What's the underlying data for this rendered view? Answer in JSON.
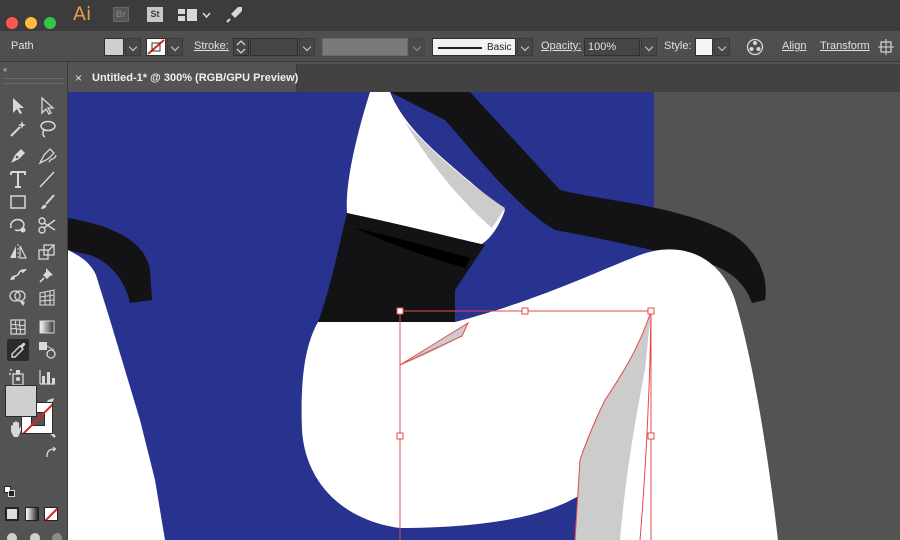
{
  "app": {
    "logo": "Ai",
    "bridge_badge": "Br",
    "stock_badge": "St"
  },
  "controlbar": {
    "selection_type": "Path",
    "fill_color": "#cfcfcf",
    "stroke_color": "none",
    "stroke_label": "Stroke:",
    "stroke_weight": "",
    "brush_profile_label": "Basic",
    "opacity_label": "Opacity:",
    "opacity_value": "100%",
    "style_label": "Style:",
    "align_label": "Align",
    "transform_label": "Transform"
  },
  "document": {
    "tab_close": "×",
    "tab_title": "Untitled-1* @ 300% (RGB/GPU Preview)"
  },
  "tools": [
    "selection-tool",
    "direct-selection-tool",
    "magic-wand-tool",
    "lasso-tool",
    "pen-tool",
    "curvature-tool",
    "type-tool",
    "line-segment-tool",
    "rectangle-tool",
    "paintbrush-tool",
    "shaper-tool",
    "scissors-tool",
    "reflect-tool",
    "scale-tool",
    "puppet-warp-tool",
    "pin-tool",
    "shape-builder-tool",
    "perspective-grid-tool",
    "mesh-tool",
    "gradient-tool",
    "eyedropper-tool",
    "blend-tool",
    "symbol-sprayer-tool",
    "column-graph-tool",
    "artboard-tool",
    "slice-tool",
    "hand-tool",
    "zoom-tool"
  ],
  "active_tool": "eyedropper-tool",
  "colors": {
    "artboard_blue": "#28328f",
    "figure_black": "#131316",
    "figure_white": "#ffffff",
    "shadow_grey": "#cccccc",
    "selection_red": "#e5484d",
    "fill_swatch": "#cfcfcf"
  }
}
